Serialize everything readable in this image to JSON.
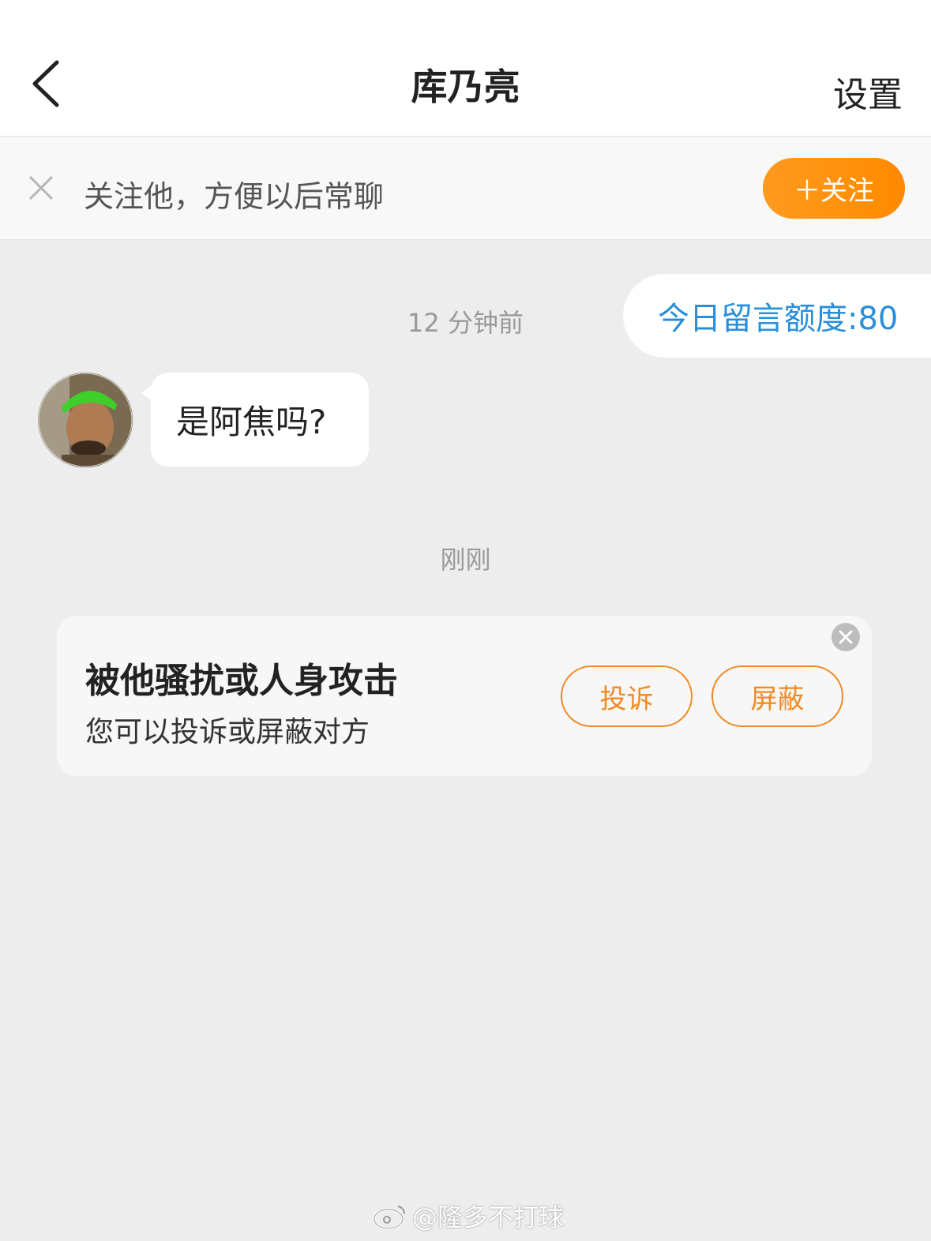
{
  "header": {
    "title": "库乃亮",
    "settings_label": "设置"
  },
  "follow_banner": {
    "text": "关注他，方便以后常聊",
    "button_label": "＋关注"
  },
  "quota": {
    "text": "今日留言额度:80"
  },
  "timestamps": {
    "first": "12 分钟前",
    "second": "刚刚"
  },
  "message": {
    "text": "是阿焦吗?"
  },
  "report_card": {
    "title": "被他骚扰或人身攻击",
    "subtitle": "您可以投诉或屏蔽对方",
    "complain_label": "投诉",
    "block_label": "屏蔽"
  },
  "watermark": {
    "text": "@隆多不打球"
  },
  "colors": {
    "accent": "#ff8a00",
    "link": "#2a8fd9",
    "background": "#ededed"
  },
  "icons": [
    "back-arrow-icon",
    "close-icon",
    "avatar",
    "close-circle-icon",
    "weibo-logo-icon"
  ]
}
